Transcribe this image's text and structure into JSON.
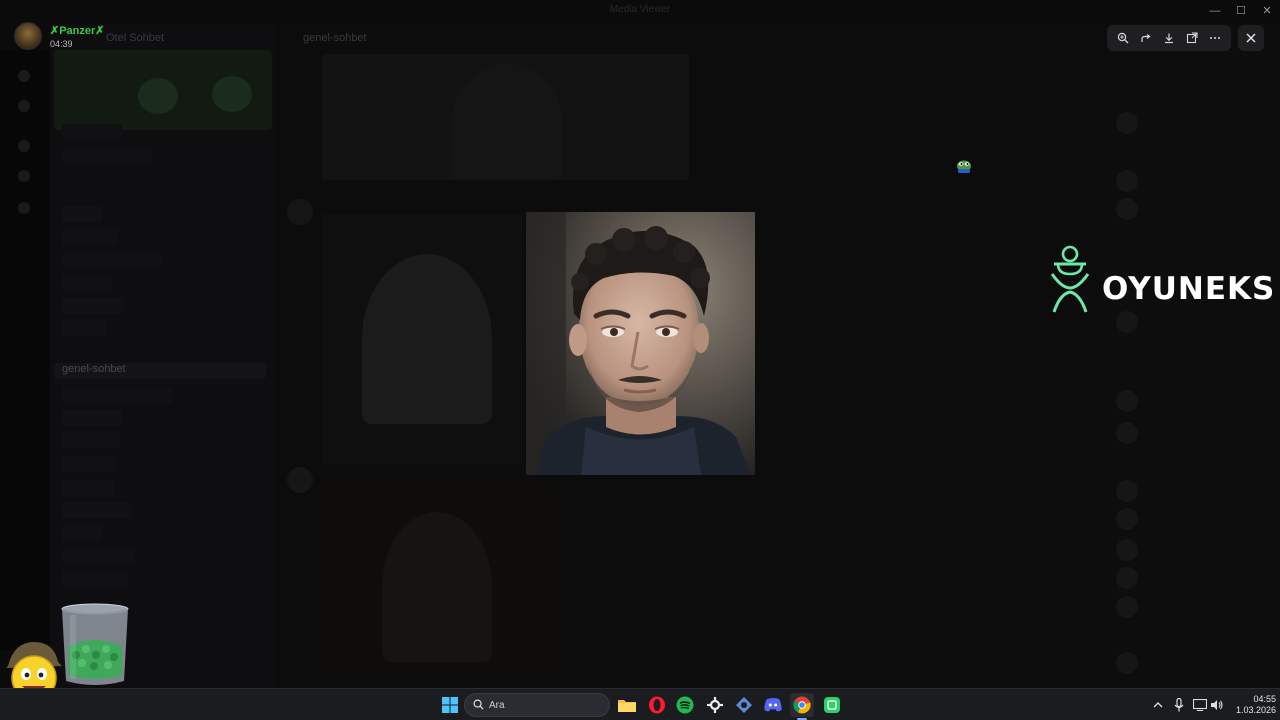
{
  "window": {
    "title": "Media Viewer"
  },
  "user": {
    "name": "✗Panzer✗",
    "time": "04:39"
  },
  "discord": {
    "server_name": "Otel Sohbet",
    "channel_title": "genel-sohbet",
    "active_channel": "genel-sohbet"
  },
  "viewer_toolbar": {
    "buttons": [
      "zoom-in-icon",
      "forward-icon",
      "download-icon",
      "open-external-icon",
      "more-icon"
    ],
    "close": "close-icon"
  },
  "overlay": {
    "logo_text": "OYUNEKS",
    "accent_color": "#6ee7a8"
  },
  "taskbar": {
    "search_placeholder": "Ara",
    "pinned": [
      "windows-start-icon",
      "search-icon",
      "file-explorer-icon",
      "opera-icon",
      "spotify-icon",
      "steelseries-icon",
      "app-icon",
      "discord-icon",
      "chrome-icon",
      "whatsapp-icon"
    ],
    "clock_time": "04:55",
    "clock_date": "1.03.2026"
  },
  "colors": {
    "username": "#3ec64a",
    "taskbar_bg": "#1b1c20",
    "spotify": "#1db954",
    "discord": "#5865f2",
    "opera": "#ff1b2d"
  }
}
